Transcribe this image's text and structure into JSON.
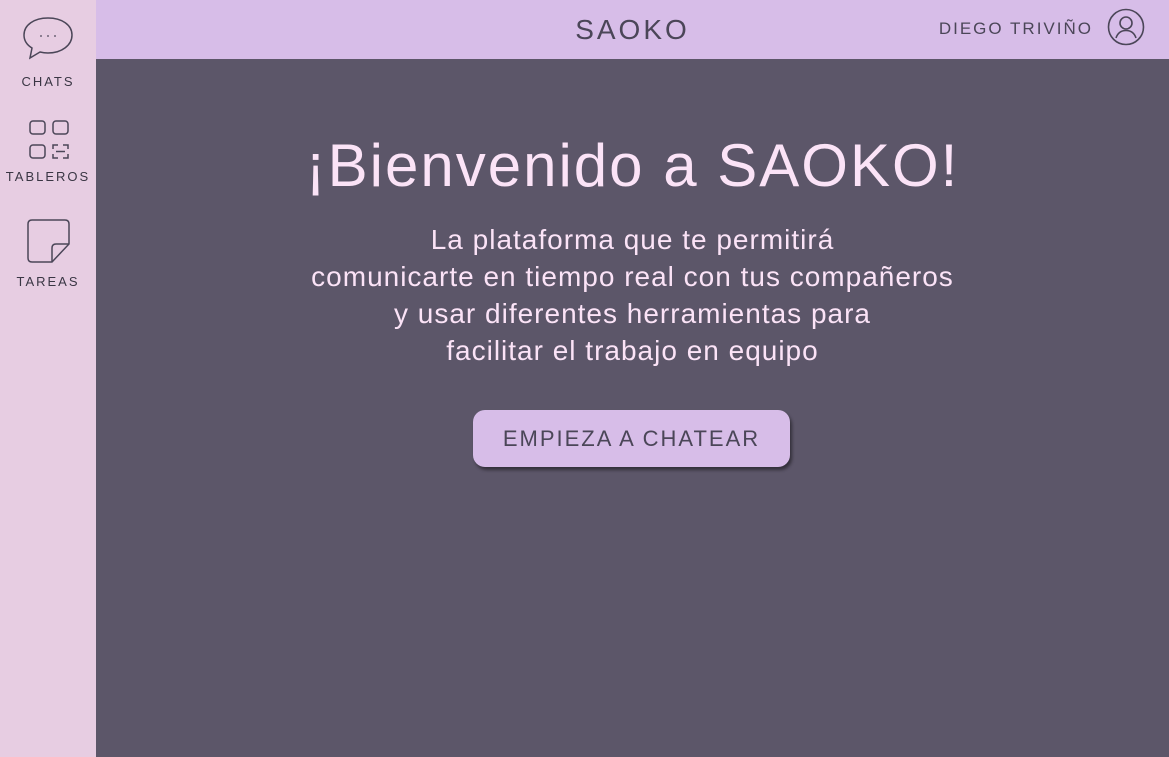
{
  "header": {
    "brand": "SAOKO",
    "user_name": "DIEGO TRIVIÑO",
    "user_icon": "user-circle-icon"
  },
  "sidebar": {
    "items": [
      {
        "label": "CHATS",
        "icon": "chat-bubble-icon"
      },
      {
        "label": "TABLEROS",
        "icon": "boards-grid-icon"
      },
      {
        "label": "TAREAS",
        "icon": "sticky-note-icon"
      }
    ]
  },
  "main": {
    "title": "¡Bienvenido a SAOKO!",
    "subtitle_lines": [
      "La plataforma que te permitirá",
      "comunicarte en tiempo real con tus compañeros",
      "y usar diferentes herramientas para",
      "facilitar el trabajo en equipo"
    ],
    "cta_label": "EMPIEZA A CHATEAR"
  },
  "colors": {
    "background": "#5c5669",
    "sidebar": "#e7cde2",
    "topbar": "#d7bde8",
    "accent_text": "#fbe3f7",
    "dark_text": "#4b4658"
  }
}
